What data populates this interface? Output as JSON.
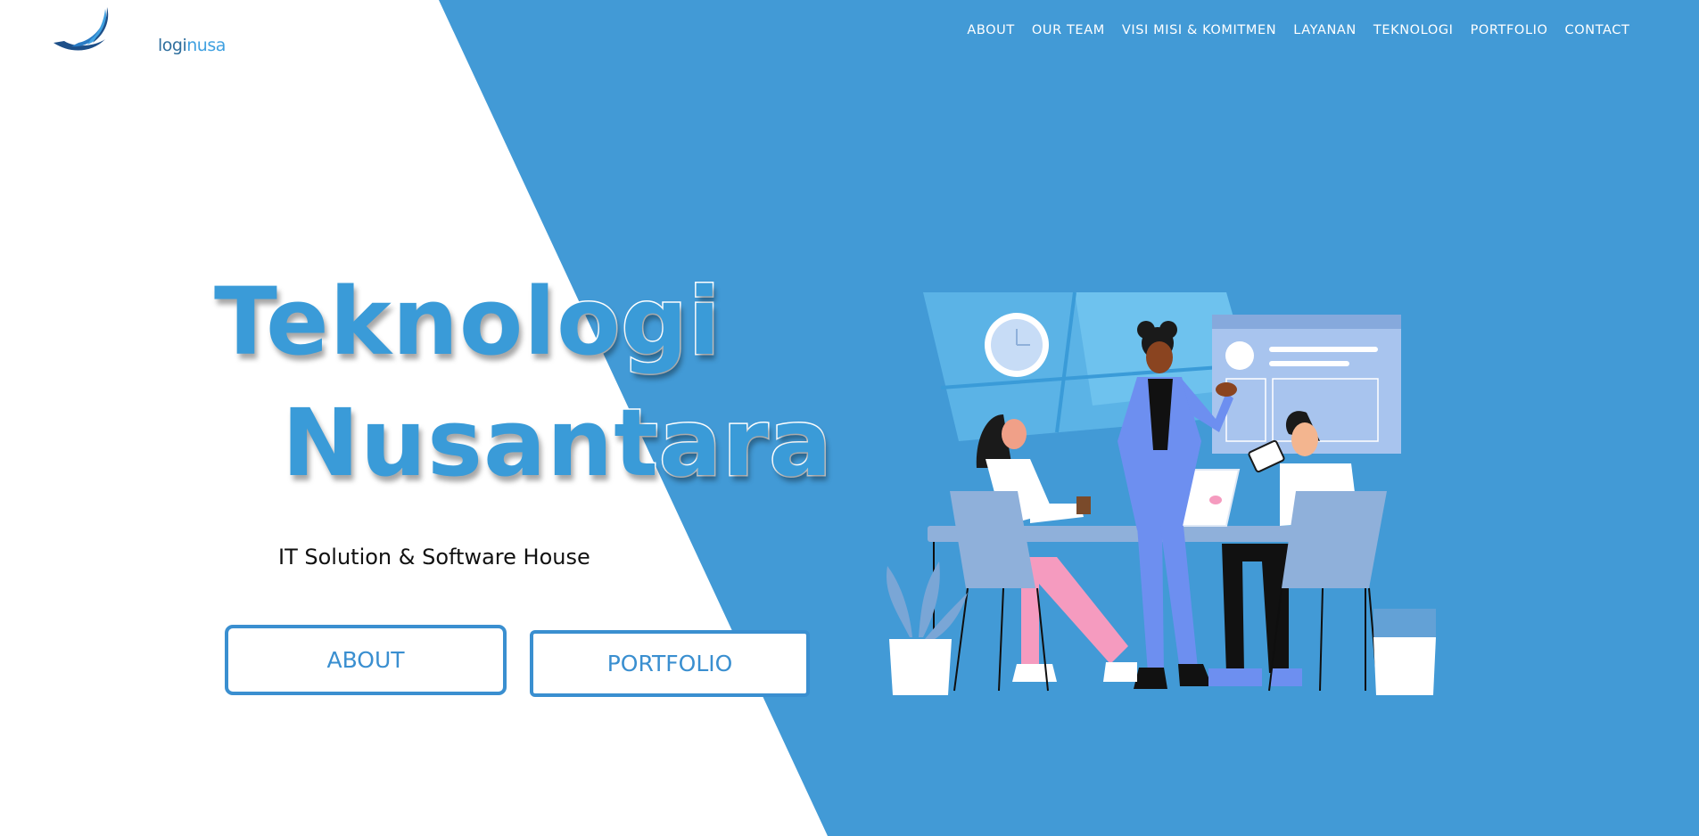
{
  "header": {
    "logo_text_a": "logi",
    "logo_text_b": "nusa"
  },
  "nav": {
    "items": [
      "ABOUT",
      "OUR TEAM",
      "VISI MISI & KOMITMEN",
      "LAYANAN",
      "TEKNOLOGI",
      "PORTFOLIO",
      "CONTACT"
    ]
  },
  "hero": {
    "title_line1": "Teknologi",
    "title_line2": "Nusantara",
    "subtitle": "IT Solution & Software House",
    "about_label": "ABOUT",
    "portfolio_label": "PORTFOLIO"
  },
  "colors": {
    "brand_blue": "#429ad6",
    "title_blue": "#3a9bd8",
    "white": "#ffffff"
  },
  "icons": {
    "logo": "logo-icon",
    "illustration": "team-meeting-illustration"
  }
}
